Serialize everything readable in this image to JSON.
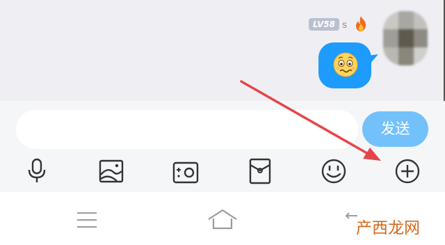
{
  "message": {
    "level_badge": "LV58",
    "username": "s",
    "bubble_emoji": "worried-face-emoji",
    "avatar": "blurred-avatar"
  },
  "input": {
    "value": "",
    "placeholder": ""
  },
  "send_label": "发送",
  "toolbar": {
    "icons": [
      "microphone-icon",
      "image-icon",
      "camera-icon",
      "red-packet-icon",
      "emoji-icon",
      "plus-icon"
    ]
  },
  "nav": {
    "icons": [
      "menu-icon",
      "home-icon",
      "back-icon"
    ]
  },
  "watermark": "产西龙网",
  "colors": {
    "send_button": "#72c1fb",
    "bubble": "#1e9bff",
    "arrow": "#e5454a",
    "level_badge": "#b9c1cf",
    "watermark": "#d2691e"
  }
}
